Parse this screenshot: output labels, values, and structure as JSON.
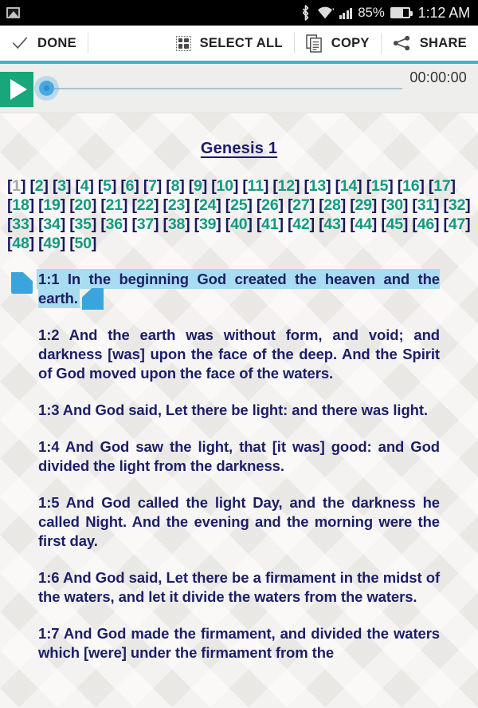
{
  "statusbar": {
    "notification_icon": "gallery-icon",
    "bluetooth_icon": "bluetooth-icon",
    "wifi_icon": "wifi-icon",
    "signal_icon": "cell-signal-icon",
    "battery_percent": "85%",
    "battery_icon": "battery-icon",
    "time": "1:12 AM"
  },
  "toolbar": {
    "done_label": "DONE",
    "select_all_label": "SELECT ALL",
    "copy_label": "COPY",
    "share_label": "SHARE",
    "accent_color": "#35b7c4"
  },
  "player": {
    "play_icon": "play-icon",
    "time_elapsed": "00:00:00",
    "progress_percent": 0,
    "play_button_color": "#17a77b",
    "thumb_color": "#4aa8e0"
  },
  "chapter": {
    "title": "Genesis 1",
    "verse_links": [
      {
        "n": "1",
        "visited": true
      },
      {
        "n": "2",
        "visited": false
      },
      {
        "n": "3",
        "visited": false
      },
      {
        "n": "4",
        "visited": false
      },
      {
        "n": "5",
        "visited": false
      },
      {
        "n": "6",
        "visited": false
      },
      {
        "n": "7",
        "visited": false
      },
      {
        "n": "8",
        "visited": false
      },
      {
        "n": "9",
        "visited": false
      },
      {
        "n": "10",
        "visited": false
      },
      {
        "n": "11",
        "visited": false
      },
      {
        "n": "12",
        "visited": false
      },
      {
        "n": "13",
        "visited": false
      },
      {
        "n": "14",
        "visited": false
      },
      {
        "n": "15",
        "visited": false
      },
      {
        "n": "16",
        "visited": false
      },
      {
        "n": "17",
        "visited": false
      },
      {
        "n": "18",
        "visited": false
      },
      {
        "n": "19",
        "visited": false
      },
      {
        "n": "20",
        "visited": false
      },
      {
        "n": "21",
        "visited": false
      },
      {
        "n": "22",
        "visited": false
      },
      {
        "n": "23",
        "visited": false
      },
      {
        "n": "24",
        "visited": false
      },
      {
        "n": "25",
        "visited": false
      },
      {
        "n": "26",
        "visited": false
      },
      {
        "n": "27",
        "visited": false
      },
      {
        "n": "28",
        "visited": false
      },
      {
        "n": "29",
        "visited": false
      },
      {
        "n": "30",
        "visited": false
      },
      {
        "n": "31",
        "visited": false
      },
      {
        "n": "32",
        "visited": false
      },
      {
        "n": "33",
        "visited": false
      },
      {
        "n": "34",
        "visited": false
      },
      {
        "n": "35",
        "visited": false
      },
      {
        "n": "36",
        "visited": false
      },
      {
        "n": "37",
        "visited": false
      },
      {
        "n": "38",
        "visited": false
      },
      {
        "n": "39",
        "visited": false
      },
      {
        "n": "40",
        "visited": false
      },
      {
        "n": "41",
        "visited": false
      },
      {
        "n": "42",
        "visited": false
      },
      {
        "n": "43",
        "visited": false
      },
      {
        "n": "44",
        "visited": false
      },
      {
        "n": "45",
        "visited": false
      },
      {
        "n": "46",
        "visited": false
      },
      {
        "n": "47",
        "visited": false
      },
      {
        "n": "48",
        "visited": false
      },
      {
        "n": "49",
        "visited": false
      },
      {
        "n": "50",
        "visited": false
      }
    ],
    "verses": [
      {
        "ref": "1:1",
        "text": "In the beginning God created the heaven and the earth.",
        "selected": true
      },
      {
        "ref": "1:2",
        "text": "And the earth was without form, and void; and darkness [was] upon the face of the deep. And the Spirit of God moved upon the face of the waters.",
        "selected": false
      },
      {
        "ref": "1:3",
        "text": "And God said, Let there be light: and there was light.",
        "selected": false
      },
      {
        "ref": "1:4",
        "text": "And God saw the light, that [it was] good: and God divided the light from the darkness.",
        "selected": false
      },
      {
        "ref": "1:5",
        "text": "And God called the light Day, and the darkness he called Night. And the evening and the morning were the first day.",
        "selected": false
      },
      {
        "ref": "1:6",
        "text": "And God said, Let there be a firmament in the midst of the waters, and let it divide the waters from the waters.",
        "selected": false
      },
      {
        "ref": "1:7",
        "text": "And God made the firmament, and divided the waters which [were] under the firmament from the",
        "selected": false
      }
    ],
    "selection_highlight_color": "#a8dcf0",
    "link_color": "#139a7f",
    "visited_link_color": "#a8a8a8",
    "text_color": "#1c1f66"
  }
}
